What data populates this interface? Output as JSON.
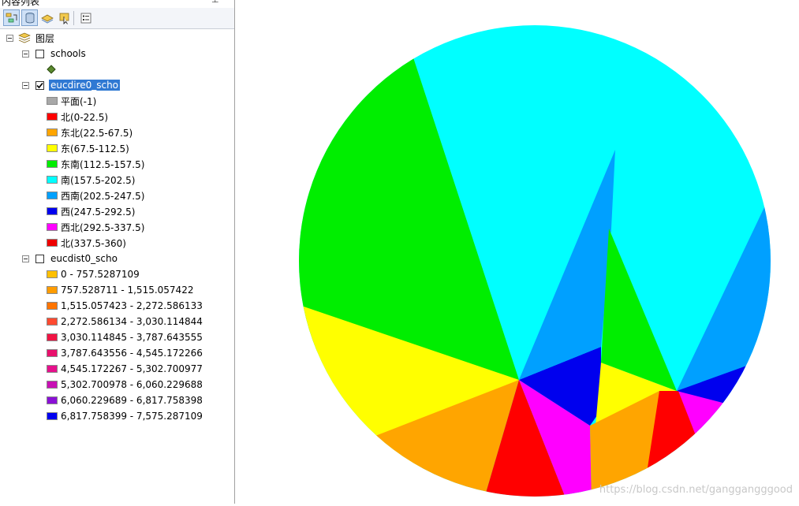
{
  "panel": {
    "title": "内容列表",
    "pin_glyph": "⊥"
  },
  "toolbar": {
    "buttons": [
      {
        "icon": "list-by-drawing-order-icon"
      },
      {
        "icon": "list-by-source-icon"
      },
      {
        "icon": "list-by-visibility-icon"
      },
      {
        "icon": "list-by-selection-icon"
      },
      {
        "icon": "options-icon"
      }
    ]
  },
  "tree": {
    "root_label": "图层",
    "schools": {
      "label": "schools",
      "checked": false
    },
    "eucdire": {
      "label": "eucdire0_scho",
      "checked": true,
      "classes": [
        {
          "label": "平面(-1)",
          "color": "#a8a8a8"
        },
        {
          "label": "北(0-22.5)",
          "color": "#ff0000"
        },
        {
          "label": "东北(22.5-67.5)",
          "color": "#ffa500"
        },
        {
          "label": "东(67.5-112.5)",
          "color": "#ffff00"
        },
        {
          "label": "东南(112.5-157.5)",
          "color": "#00ee00"
        },
        {
          "label": "南(157.5-202.5)",
          "color": "#00ffff"
        },
        {
          "label": "西南(202.5-247.5)",
          "color": "#00a0ff"
        },
        {
          "label": "西(247.5-292.5)",
          "color": "#0000ee"
        },
        {
          "label": "西北(292.5-337.5)",
          "color": "#ff00ff"
        },
        {
          "label": "北(337.5-360)",
          "color": "#ee0000"
        }
      ]
    },
    "eucdist": {
      "label": "eucdist0_scho",
      "checked": false,
      "classes": [
        {
          "label": "0 - 757.5287109",
          "color": "#ffc000"
        },
        {
          "label": "757.528711 - 1,515.057422",
          "color": "#ff9c00"
        },
        {
          "label": "1,515.057423 - 2,272.586133",
          "color": "#ff7400"
        },
        {
          "label": "2,272.586134 - 3,030.114844",
          "color": "#ff4a30"
        },
        {
          "label": "3,030.114845 - 3,787.643555",
          "color": "#f01444"
        },
        {
          "label": "3,787.643556 - 4,545.172266",
          "color": "#e8106c"
        },
        {
          "label": "4,545.172267 - 5,302.700977",
          "color": "#e6108c"
        },
        {
          "label": "5,302.700978 - 6,060.229688",
          "color": "#c810b4"
        },
        {
          "label": "6,060.229689 - 6,817.758398",
          "color": "#8a10d6"
        },
        {
          "label": "6,817.758399 - 7,575.287109",
          "color": "#0000f0"
        }
      ]
    }
  },
  "map": {
    "watermark": "https://blog.csdn.net/ganggangggood"
  }
}
